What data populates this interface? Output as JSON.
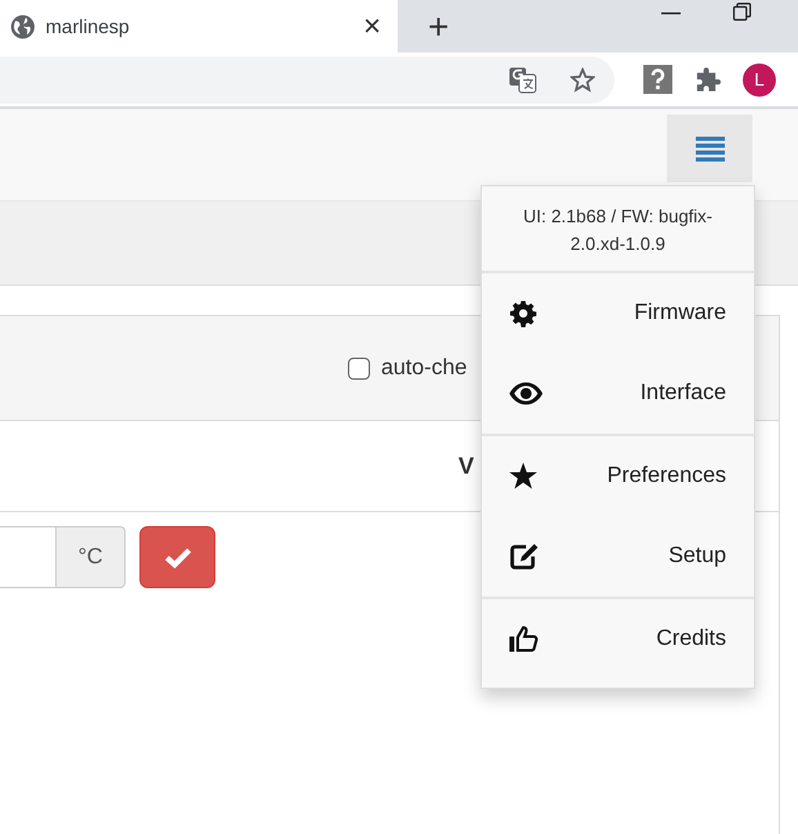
{
  "browser": {
    "tab_title": "marlinesp",
    "tab_close": "×",
    "new_tab": "+",
    "avatar_letter": "L"
  },
  "panel": {
    "auto_check": {
      "label": "auto-che",
      "checked": false
    },
    "column_label": "V",
    "unit": "°C"
  },
  "menu": {
    "version": "UI: 2.1b68 / FW: bugfix-2.0.xd-1.0.9",
    "groups": [
      [
        {
          "kind": "gear",
          "label": "Firmware"
        },
        {
          "kind": "eye",
          "label": "Interface"
        }
      ],
      [
        {
          "kind": "star",
          "label": "Preferences"
        },
        {
          "kind": "edit",
          "label": "Setup"
        }
      ],
      [
        {
          "kind": "thumb",
          "label": "Credits"
        }
      ]
    ]
  }
}
